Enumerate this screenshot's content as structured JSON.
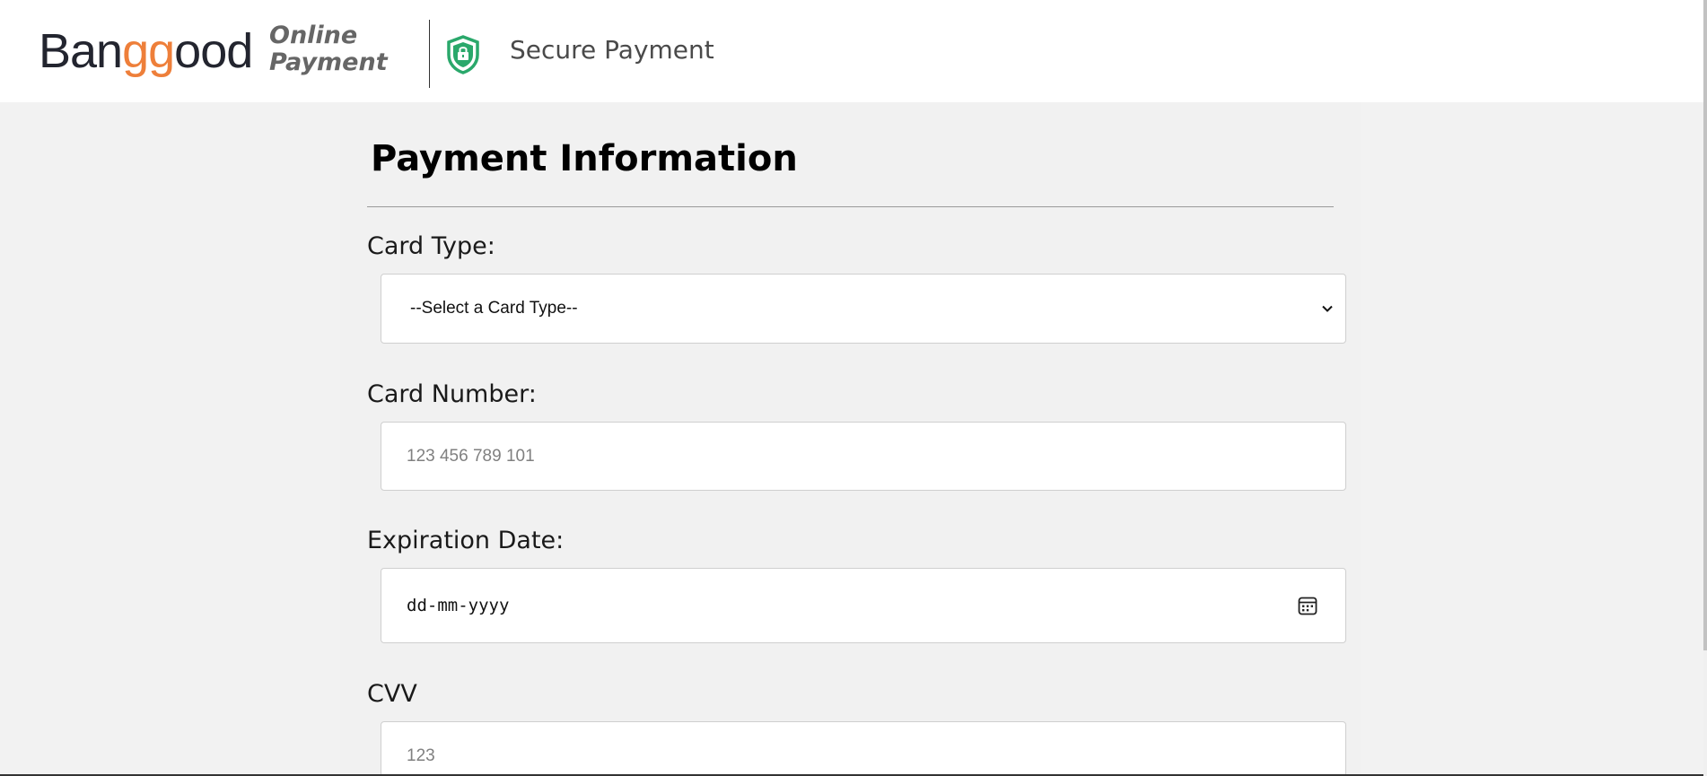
{
  "header": {
    "logo_prefix": "Ban",
    "logo_accent": "gg",
    "logo_suffix": "ood",
    "logo_sub_line1": "Online",
    "logo_sub_line2": "Payment",
    "secure_label": "Secure Payment",
    "secure_icon": "shield-lock-icon",
    "accent_color": "#ee7f3a",
    "shield_color": "#2aa86b"
  },
  "form": {
    "title": "Payment Information",
    "card_type": {
      "label": "Card Type:",
      "selected": "--Select a Card Type--"
    },
    "card_number": {
      "label": "Card Number:",
      "placeholder": "123 456 789 101"
    },
    "expiration": {
      "label": "Expiration Date:",
      "placeholder": "dd-mm-yyyy"
    },
    "cvv": {
      "label": "CVV",
      "placeholder": "123"
    }
  }
}
